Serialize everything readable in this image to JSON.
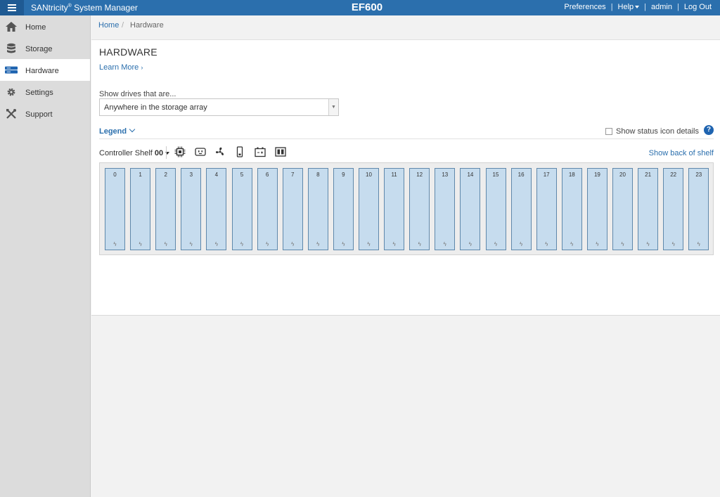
{
  "header": {
    "brand_prefix": "SANtricity",
    "brand_reg": "®",
    "brand_suffix": " System Manager",
    "device_name": "EF600",
    "nav": {
      "preferences": "Preferences",
      "help": "Help",
      "user": "admin",
      "logout": "Log Out"
    }
  },
  "sidebar": {
    "items": [
      {
        "label": "Home",
        "icon": "home-icon"
      },
      {
        "label": "Storage",
        "icon": "database-icon"
      },
      {
        "label": "Hardware",
        "icon": "hardware-icon",
        "active": true
      },
      {
        "label": "Settings",
        "icon": "gear-icon"
      },
      {
        "label": "Support",
        "icon": "tools-icon"
      }
    ]
  },
  "breadcrumb": {
    "home": "Home",
    "separator": "/",
    "current": "Hardware"
  },
  "page": {
    "title": "HARDWARE",
    "learn_more": "Learn More",
    "filter_label": "Show drives that are...",
    "filter_value": "Anywhere in the storage array",
    "legend": "Legend",
    "show_status_details": "Show status icon details",
    "help_glyph": "?",
    "shelf_label": "Controller Shelf",
    "shelf_number": "00",
    "show_back": "Show back of shelf",
    "toolbar_icons": [
      "controller-icon",
      "power-supply-icon",
      "fan-icon",
      "drive-icon",
      "battery-icon",
      "shelf-view-icon"
    ]
  },
  "drives": {
    "numbers": [
      "0",
      "1",
      "2",
      "3",
      "4",
      "5",
      "6",
      "7",
      "8",
      "9",
      "10",
      "11",
      "12",
      "13",
      "14",
      "15",
      "16",
      "17",
      "18",
      "19",
      "20",
      "21",
      "22",
      "23"
    ],
    "status_glyph": "ϟ",
    "fill_color": "#c6dcee",
    "border_color": "#5f88ab"
  },
  "colors": {
    "accent": "#2b6fad",
    "sidebar": "#dcdcdc",
    "background": "#f2f2f2"
  }
}
